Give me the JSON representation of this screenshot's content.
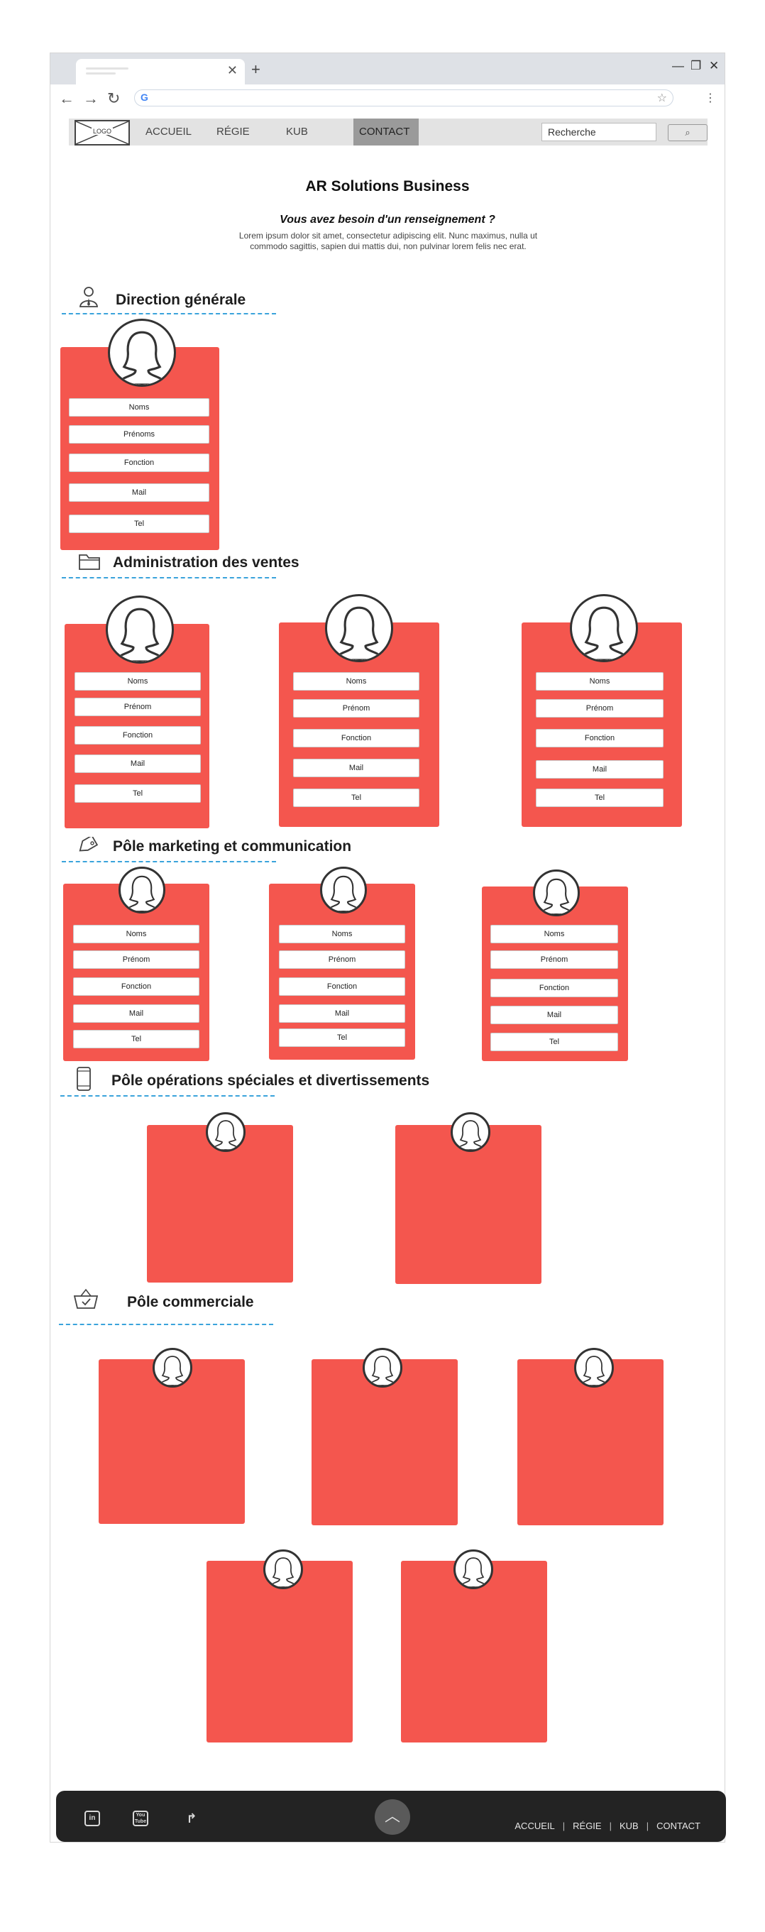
{
  "browser": {
    "new_tab_icon": "plus-icon",
    "window_controls": [
      "minimize-icon",
      "restore-icon",
      "close-icon"
    ],
    "nav_icons": [
      "back-arrow-icon",
      "forward-arrow-icon",
      "reload-icon"
    ]
  },
  "nav": {
    "logo": "LOGO",
    "links": [
      "ACCUEIL",
      "RÉGIE",
      "KUB",
      "CONTACT"
    ],
    "active": "CONTACT",
    "search_value": "Recherche",
    "search_icon": "magnifier-icon"
  },
  "header": {
    "title": "AR Solutions Business",
    "subtitle": "Vous avez besoin d'un renseignement ?",
    "body": "Lorem ipsum dolor sit amet, consectetur adipiscing elit. Nunc maximus, nulla ut commodo sagittis, sapien dui mattis dui, non pulvinar lorem felis nec erat."
  },
  "sections": [
    {
      "title": "Direction générale",
      "icon": "person-icon"
    },
    {
      "title": "Administration des ventes",
      "icon": "folder-icon"
    },
    {
      "title": "Pôle marketing et communication",
      "icon": "tag-icon"
    },
    {
      "title": "Pôle opérations spéciales et divertissements",
      "icon": "smartphone-icon"
    },
    {
      "title": "Pôle commerciale",
      "icon": "basket-icon"
    }
  ],
  "cards": {
    "direction": [
      [
        "Noms",
        "Prénoms",
        "Fonction",
        "Mail",
        "Tel"
      ]
    ],
    "admin": [
      [
        "Noms",
        "Prénom",
        "Fonction",
        "Mail",
        "Tel"
      ],
      [
        "Noms",
        "Prénom",
        "Fonction",
        "Mail",
        "Tel"
      ],
      [
        "Noms",
        "Prénom",
        "Fonction",
        "Mail",
        "Tel"
      ]
    ],
    "marketing": [
      [
        "Noms",
        "Prénom",
        "Fonction",
        "Mail",
        "Tel"
      ],
      [
        "Noms",
        "Prénom",
        "Fonction",
        "Mail",
        "Tel"
      ],
      [
        "Noms",
        "Prénom",
        "Fonction",
        "Mail",
        "Tel"
      ]
    ]
  },
  "footer": {
    "social": [
      "in",
      "You Tube",
      "share-icon"
    ],
    "links": [
      "ACCUEIL",
      "RÉGIE",
      "KUB",
      "CONTACT"
    ],
    "up_icon": "chevron-up-icon"
  },
  "colors": {
    "card": "#f4564e",
    "divider": "#3aa3db",
    "footer": "#232323"
  }
}
